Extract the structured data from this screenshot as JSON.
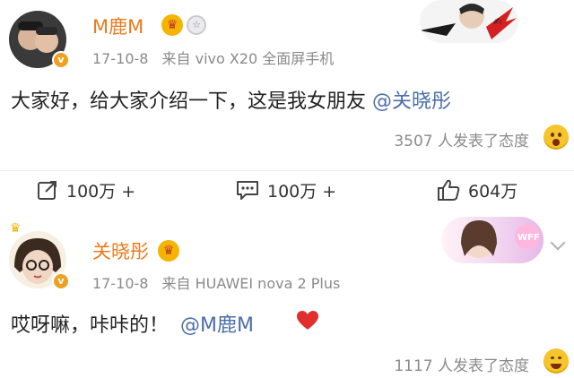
{
  "post1": {
    "username": "M鹿M",
    "time": "17-10-8",
    "source": "来自 vivo X20 全面屏手机",
    "content_text": "大家好，给大家介绍一下，这是我女朋友 ",
    "content_mention": "@关晓彤",
    "reactions": "3507 人发表了态度"
  },
  "actions": {
    "repost_count": "100万 +",
    "comment_count": "100万 +",
    "like_count": "604万"
  },
  "post2": {
    "username": "关晓彤",
    "time": "17-10-8",
    "source": "来自 HUAWEI nova 2 Plus",
    "content_text": "哎呀嘛，咔咔的！",
    "content_mention": "@M鹿M",
    "reactions": "1117 人发表了态度"
  },
  "colors": {
    "username": "#ea7a1c",
    "mention": "#4b6fa8",
    "meta": "#8a8a8a",
    "heart": "#e0302e"
  },
  "icons": {
    "repost": "repost-icon",
    "comment": "comment-icon",
    "like": "thumbs-up-icon",
    "verified": "verified-badge-icon",
    "crown": "vip-crown-icon",
    "heart": "heart-icon",
    "emoji": "surprised-face-icon",
    "more": "chevron-down-icon"
  }
}
